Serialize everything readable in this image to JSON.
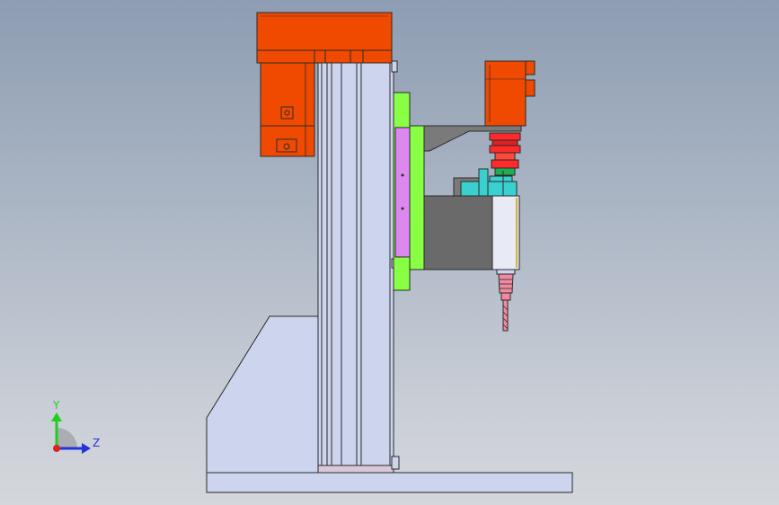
{
  "viewport": {
    "background_top": "#8e9db3",
    "background_bottom": "#d4d7dc"
  },
  "colors": {
    "motor_orange": "#f04a00",
    "column_blue": "#cdd4ee",
    "base_blue": "#cdd4ee",
    "edge": "#2a2a2a",
    "plate_green": "#88ff44",
    "slider_purple": "#dd88f0",
    "head_gray": "#6a6a6a",
    "coupling_red": "#ff2a2a",
    "bracket_teal": "#3ad0d0",
    "chuck_pink": "#f08aa0"
  },
  "triad": {
    "y_label": "Y",
    "z_label": "Z",
    "y_axis_color": "#22cc22",
    "z_axis_color": "#2233dd",
    "origin_color": "#dd2222"
  }
}
